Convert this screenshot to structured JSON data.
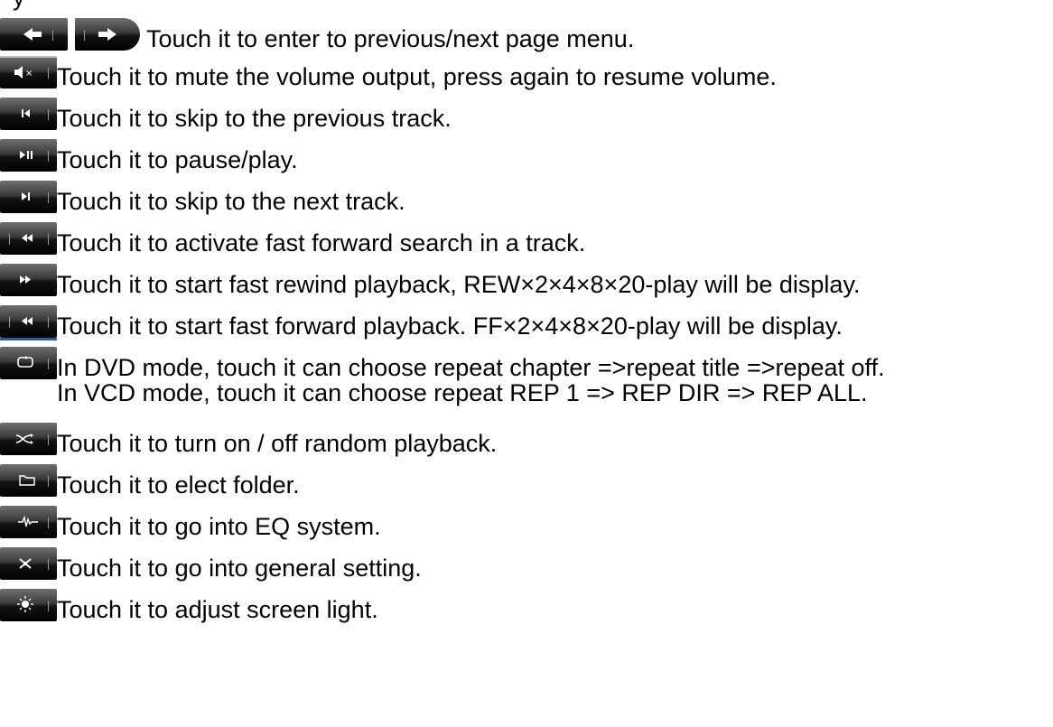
{
  "top_fragment": "y",
  "rows": [
    {
      "text": "Touch it to enter to previous/next page menu."
    },
    {
      "text": "Touch it to mute the volume output, press again to resume volume."
    },
    {
      "text": "Touch it to skip to the previous track."
    },
    {
      "text": "Touch it to pause/play."
    },
    {
      "text": "Touch it to skip to the next track."
    },
    {
      "text": "Touch it to activate fast forward search in a track."
    },
    {
      "text": "Touch it to start fast rewind playback, REW×2×4×8×20-play will be display."
    },
    {
      "text": "Touch it to start fast forward playback. FF×2×4×8×20-play will be display."
    },
    {
      "text": "In DVD mode, touch it can choose repeat chapter =>repeat title =>repeat off.",
      "text2": "In VCD mode, touch it can choose repeat REP 1 => REP DIR => REP ALL."
    },
    {
      "text": "Touch it to turn on / off random playback."
    },
    {
      "text": "Touch it to elect folder."
    },
    {
      "text": "Touch it to go into EQ system."
    },
    {
      "text": "Touch it to go into general setting."
    },
    {
      "text": "Touch it to adjust screen light."
    }
  ],
  "icons": [
    "back-arrow-icon",
    "forward-arrow-icon",
    "mute-icon",
    "previous-track-icon",
    "play-pause-icon",
    "next-track-icon",
    "fast-search-icon",
    "rewind-icon",
    "fast-forward-icon",
    "repeat-icon",
    "shuffle-icon",
    "folder-icon",
    "eq-icon",
    "settings-icon",
    "brightness-icon"
  ]
}
